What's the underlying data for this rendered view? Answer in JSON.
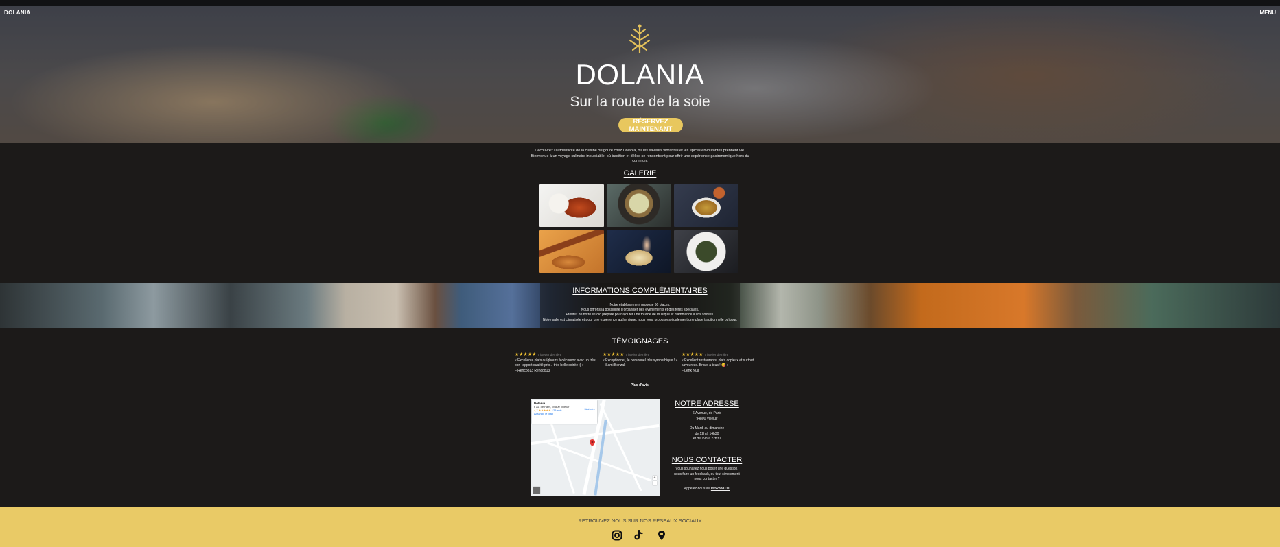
{
  "header": {
    "brand": "DOLANIA",
    "menu_label": "MENU"
  },
  "hero": {
    "title": "DOLANIA",
    "subtitle": "Sur la route de la soie",
    "cta_label": "RÉSERVEZ MAINTENANT",
    "logo_icon": "dolania-logo-icon"
  },
  "intro": {
    "text": "Découvrez l'authenticité de la cuisine ouïgoure chez Dolania, où les saveurs vibrantes et les épices envoûtantes prennent vie. Bienvenue à un voyage culinaire inoubliable, où tradition et délice se rencontrent pour offrir une expérience gastronomique hors du commun."
  },
  "gallery": {
    "title": "GALERIE",
    "images": [
      "gallery-photo-1",
      "gallery-photo-2",
      "gallery-photo-3",
      "gallery-photo-4",
      "gallery-photo-5",
      "gallery-photo-6"
    ]
  },
  "info": {
    "title": "INFORMATIONS COMPLÉMENTAIRES",
    "lines": [
      "Notre établissement propose 60 places.",
      "Nous offrons la possibilité d'organiser des événements et des fêtes spéciales.",
      "Profitez de notre studio préparé pour ajouter une touche de musique et d'ambiance à vos soirées.",
      "Notre salle est climatisée et pour une expérience authentique, nous vous proposons également une place traditionnelle ouïgour."
    ]
  },
  "testimonials": {
    "title": "TÉMOIGNAGES",
    "stars": "★★★★★",
    "source": "7 janvier dernière",
    "items": [
      {
        "line1": "« Excellente plats ouïghours à découvrir avec un très",
        "line2": "bon rapport qualité prix... très belle soirée :) »",
        "author": "– Rencoo13 Rencoo13"
      },
      {
        "line1": "« Exceptionnel, le personnel très sympathique ! »",
        "line2": "",
        "author": "– Sami Benzali"
      },
      {
        "line1": "« Excellent restaurants, plats copieux et surtout,",
        "line2": "savoureux. Bravo à tous ! 😋 »",
        "author": "– Lenk Nua"
      }
    ],
    "more_link": "Plus d'avis"
  },
  "map": {
    "place_name": "Dolania",
    "address_short": "6 Av. de Paris, 94800 Villejuif",
    "rating": "4,7 ★★★★★",
    "reviews_link": "129 avis",
    "bigger_map": "Agrandir le plan",
    "directions": "Itinéraire"
  },
  "address": {
    "title": "NOTRE ADRESSE",
    "street": "6 Avenue, de Paris",
    "city": "94800 Villejuif",
    "hours_title": "Du Mardi au dimanche",
    "hours_1": "de 12h à 14h30",
    "hours_2": "et de 19h à 22h30"
  },
  "contact": {
    "title": "NOUS CONTACTER",
    "line1": "Vous souhaitez nous poser une question,",
    "line2": "nous faire un feedback, ou tout simplement",
    "line3": "nous contacter ?",
    "call_prefix": "Appelez-nous au",
    "phone": "0952888111"
  },
  "footer": {
    "text": "RETROUVEZ NOUS SUR NOS RÉSEAUX SOCIAUX",
    "icons": [
      "instagram-icon",
      "tiktok-icon",
      "location-pin-icon"
    ]
  },
  "colors": {
    "accent": "#e9ca66",
    "background": "#1c1a19",
    "cta": "#e8c75e",
    "stars": "#f1c232"
  }
}
